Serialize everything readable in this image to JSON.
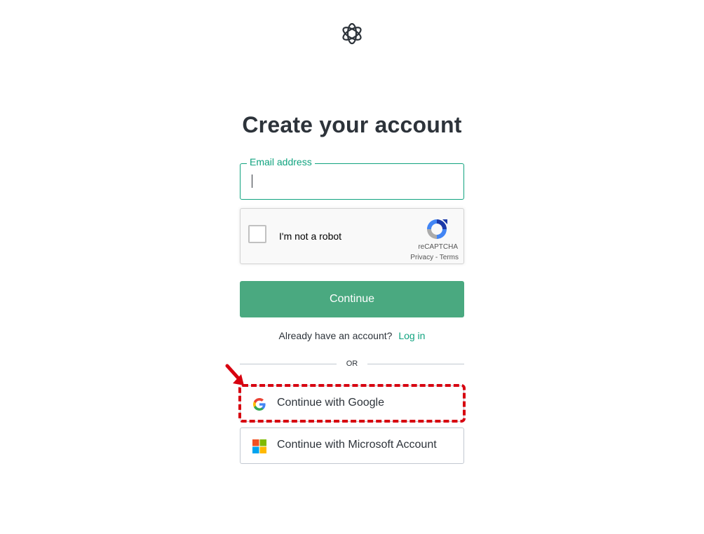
{
  "page": {
    "logo": "openai-logo",
    "title": "Create your account"
  },
  "email": {
    "label": "Email address",
    "value": "",
    "placeholder": ""
  },
  "captcha": {
    "label": "I'm not a robot",
    "brand": "reCAPTCHA",
    "links": "Privacy - Terms",
    "checked": false
  },
  "actions": {
    "continue_label": "Continue"
  },
  "login": {
    "prompt": "Already have an account?",
    "link_label": "Log in"
  },
  "divider": {
    "label": "OR"
  },
  "social": {
    "google": {
      "label": "Continue with Google",
      "icon": "google-icon"
    },
    "microsoft": {
      "label": "Continue with Microsoft Account",
      "icon": "microsoft-icon"
    }
  },
  "annotation": {
    "color": "#d7000f",
    "target": "continue-with-google-button"
  },
  "colors": {
    "accent": "#10a37f",
    "button": "#4aa980",
    "text": "#2d333a",
    "border": "#c2c8d0"
  }
}
